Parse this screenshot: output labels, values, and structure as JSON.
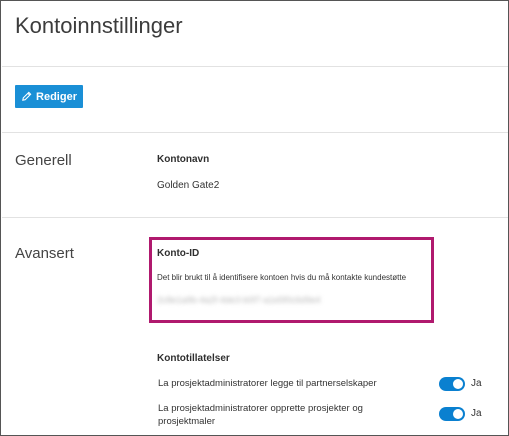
{
  "page": {
    "title": "Kontoinnstillinger"
  },
  "toolbar": {
    "edit_label": "Rediger"
  },
  "sections": {
    "general": {
      "label": "Generell",
      "account_name_label": "Kontonavn",
      "account_name_value": "Golden Gate2"
    },
    "advanced": {
      "label": "Avansert",
      "account_id_label": "Konto-ID",
      "account_id_description": "Det blir brukt til å identifisere kontoen hvis du må kontakte kundestøtte",
      "account_id_value": "2c8e1a9b-4a2f-4de3-b0f7-a1e5f0c6d9e4",
      "permissions_label": "Kontotillatelser",
      "permissions": [
        {
          "label": "La prosjektadministratorer legge til partnerselskaper",
          "toggle_label": "Ja",
          "enabled": true
        },
        {
          "label": "La prosjektadministratorer opprette prosjekter og prosjektmaler",
          "toggle_label": "Ja",
          "enabled": true
        }
      ]
    }
  },
  "colors": {
    "primary": "#1a8fd6",
    "toggle_on": "#0a80d0",
    "highlight": "#b0196e"
  }
}
